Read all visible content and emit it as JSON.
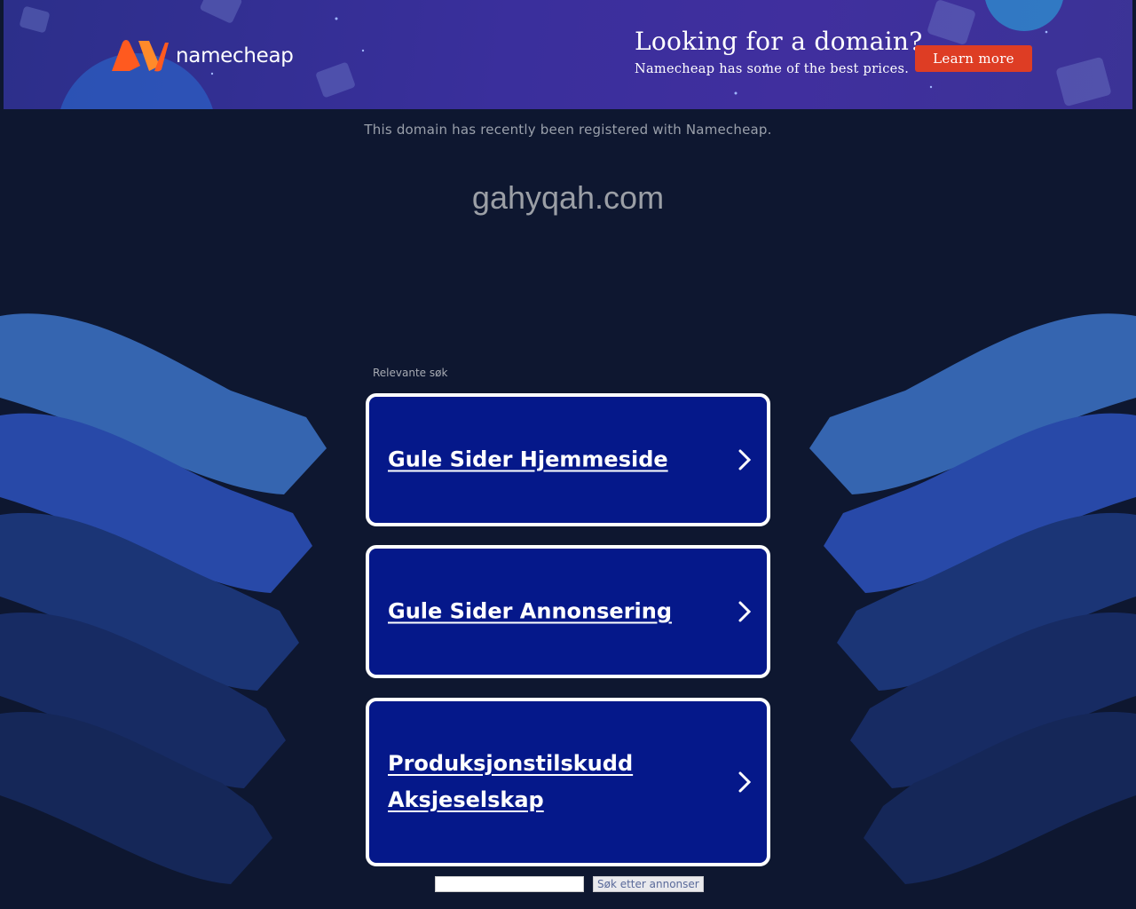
{
  "banner": {
    "logo_text": "namecheap",
    "promo_title": "Looking for a domain?",
    "promo_subtitle": "Namecheap has some of the best prices.",
    "cta_label": "Learn more"
  },
  "notice": "This domain has recently been registered with Namecheap.",
  "domain": "gahyqah.com",
  "related": {
    "label": "Relevante søk",
    "items": [
      {
        "label": "Gule Sider Hjemmeside"
      },
      {
        "label": "Gule Sider Annonsering"
      },
      {
        "label": "Produksjonstilskudd Aksjeselskap"
      }
    ]
  },
  "search": {
    "value": "",
    "button_label": "Søk etter annonser"
  },
  "colors": {
    "page_bg": "#0e1730",
    "card_bg": "#05188a",
    "cta_bg": "#de3d24",
    "logo_orange": "#ff6a1a"
  }
}
